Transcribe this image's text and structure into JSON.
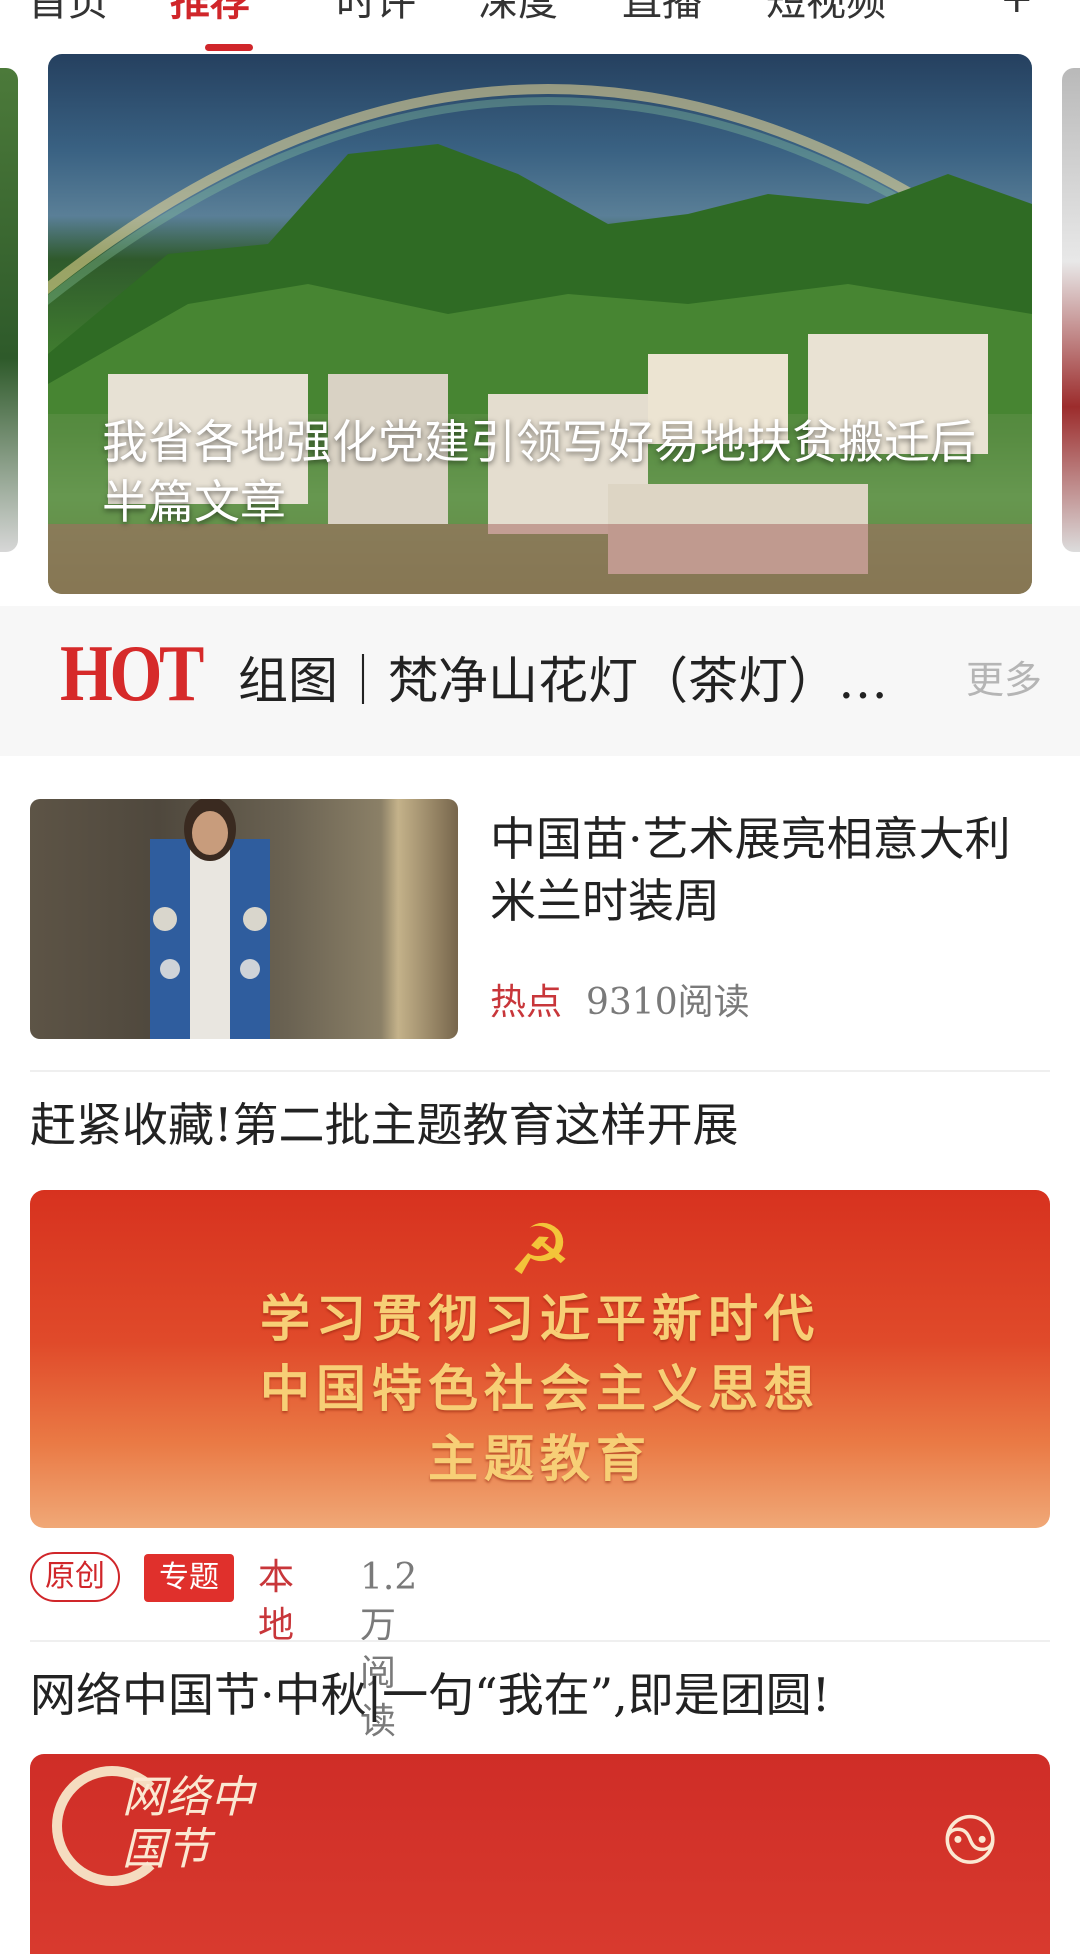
{
  "nav": {
    "tabs": [
      {
        "label": "首页"
      },
      {
        "label": "推荐"
      },
      {
        "label": "时评"
      },
      {
        "label": "深度"
      },
      {
        "label": "直播"
      },
      {
        "label": "短视频"
      }
    ],
    "active_tab": "推荐",
    "add_icon": "plus-icon"
  },
  "hero": {
    "caption": "我省各地强化党建引领写好易地扶贫搬迁后半篇文章"
  },
  "hot": {
    "logo_text": "HOT",
    "headline": "组图｜梵净山花灯（茶灯）…",
    "more_label": "更多"
  },
  "feed": {
    "item1": {
      "title": "中国苗·艺术展亮相意大利米兰时装周",
      "tag": "热点",
      "reads": "9310阅读"
    },
    "item2": {
      "title": "赶紧收藏!第二批主题教育这样开展",
      "banner_lines": [
        "学习贯彻习近平新时代",
        "中国特色社会主义思想",
        "主题教育"
      ],
      "tag_original": "原创",
      "tag_topic": "专题",
      "tag_local": "本地",
      "reads": "1.2万阅读"
    },
    "item3": {
      "title": "网络中国节·中秋|一句“我在”,即是团圆!",
      "banner_logo_text": "网络中国节"
    }
  },
  "colors": {
    "accent": "#d0262a",
    "hot_logo": "#d62a2a",
    "banner_red": "#d7321f",
    "banner_gold": "#f7cf76"
  }
}
